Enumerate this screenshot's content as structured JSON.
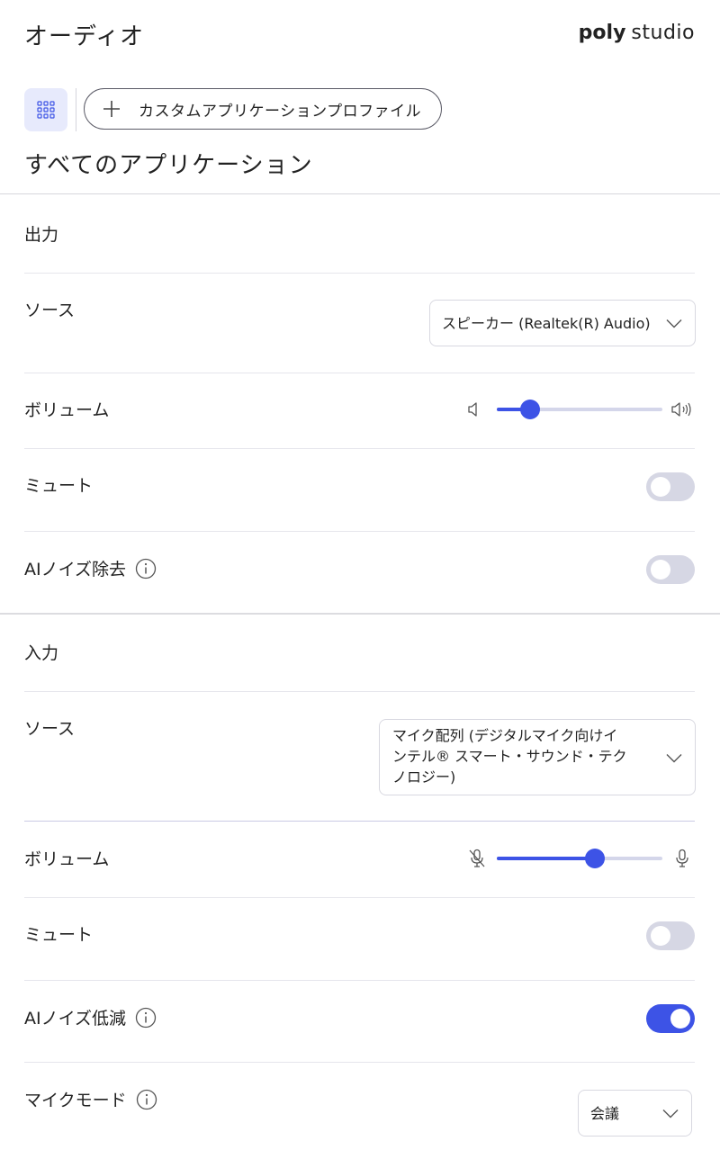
{
  "header": {
    "title": "オーディオ",
    "brand_bold": "poly",
    "brand_light": "studio"
  },
  "toolbar": {
    "apps_icon": "grid-icon",
    "custom_profile_label": "カスタムアプリケーションプロファイル"
  },
  "page": {
    "subtitle": "すべてのアプリケーション"
  },
  "output": {
    "section_label": "出力",
    "source_label": "ソース",
    "source_value": "スピーカー (Realtek(R) Audio)",
    "volume_label": "ボリューム",
    "volume_level": 0.2,
    "mute_label": "ミュート",
    "mute_on": false,
    "noise_label": "AIノイズ除去",
    "noise_on": false
  },
  "input": {
    "section_label": "入力",
    "source_label": "ソース",
    "source_value_line1": "マイク配列 (デジタルマイク向けイ",
    "source_value_line2": "ンテル® スマート・サウンド・テク",
    "source_value_line3": "ノロジー)",
    "volume_label": "ボリューム",
    "volume_level": 0.59,
    "mute_label": "ミュート",
    "mute_on": false,
    "noise_label": "AIノイズ低減",
    "noise_on": true,
    "mic_mode_label": "マイクモード",
    "mic_mode_value": "会議"
  },
  "colors": {
    "accent": "#3d53e6",
    "toggle_off": "#d6d7e4",
    "apps_button_bg": "#e7eafc"
  }
}
